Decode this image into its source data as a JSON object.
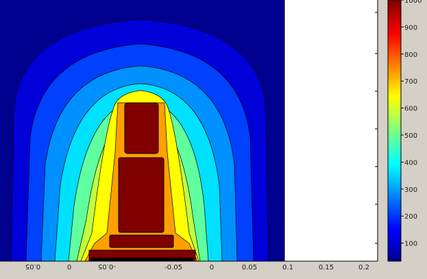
{
  "plot": {
    "x_tick_labels_mirrored": [
      "0.05",
      "0",
      "-0.05"
    ],
    "x_tick_labels_mirrored_b": [
      "-0.05",
      "0",
      "0.05"
    ],
    "x_tick_labels": [
      "0.1",
      "0.15",
      "0.2"
    ],
    "right_panel_ticks_count": 6
  },
  "colorbar": {
    "tick_labels": [
      "1000",
      "900",
      "800",
      "700",
      "600",
      "500",
      "400",
      "300",
      "200",
      "100"
    ]
  },
  "colors": {
    "background": "#00008f",
    "contours": [
      "#00008f",
      "#0000d8",
      "#0040ff",
      "#0090ff",
      "#00e0ff",
      "#60ffa0",
      "#c0ff40",
      "#ffff00",
      "#ffa000",
      "#800000"
    ]
  }
}
